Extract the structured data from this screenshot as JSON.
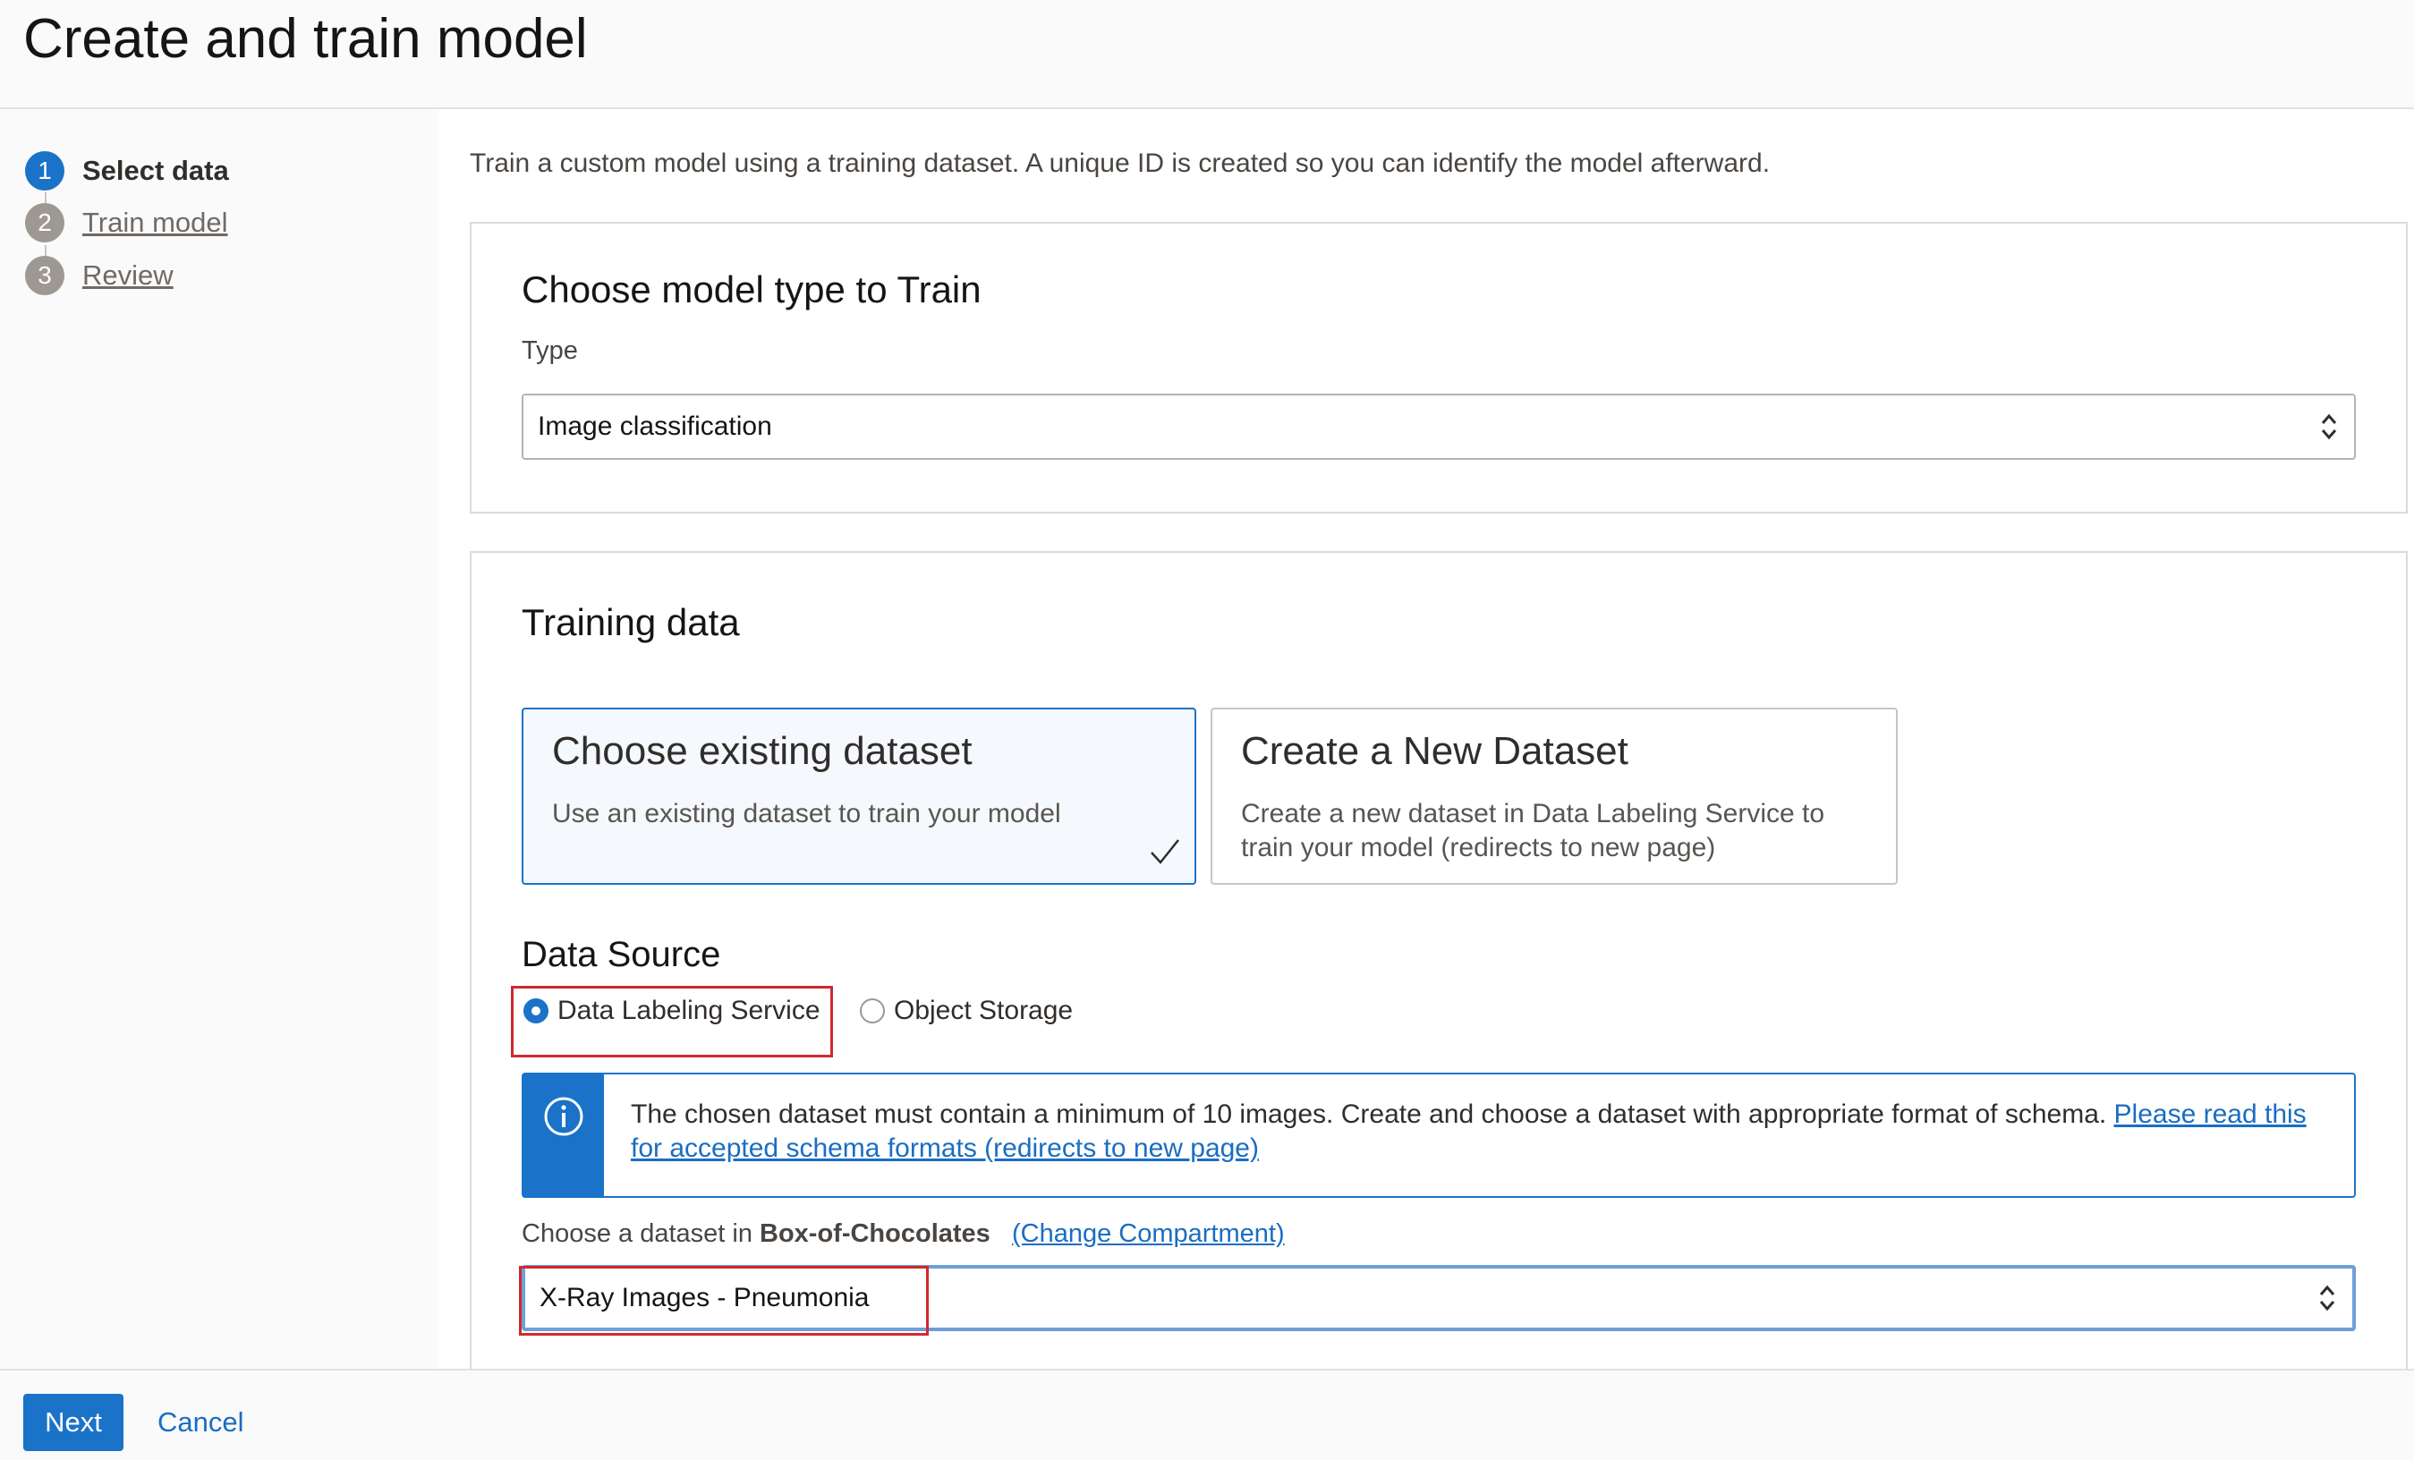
{
  "header": {
    "title": "Create and train model"
  },
  "steps": [
    {
      "num": "1",
      "label": "Select data"
    },
    {
      "num": "2",
      "label": "Train model"
    },
    {
      "num": "3",
      "label": "Review"
    }
  ],
  "intro": "Train a custom model using a training dataset. A unique ID is created so you can identify the model afterward.",
  "model_type": {
    "title": "Choose model type to Train",
    "type_label": "Type",
    "type_value": "Image classification"
  },
  "training_data": {
    "title": "Training data",
    "tiles": [
      {
        "title": "Choose existing dataset",
        "desc": "Use an existing dataset to train your model"
      },
      {
        "title": "Create a New Dataset",
        "desc": "Create a new dataset in Data Labeling Service to train your model (redirects to new page)"
      }
    ],
    "data_source_label": "Data Source",
    "radios": [
      {
        "label": "Data Labeling Service"
      },
      {
        "label": "Object Storage"
      }
    ],
    "info_text": "The chosen dataset must contain a minimum of 10 images. Create and choose a dataset with appropriate format of schema. ",
    "info_link": "Please read this for accepted schema formats (redirects to new page)",
    "dataset_prefix": "Choose a dataset in ",
    "compartment": "Box-of-Chocolates",
    "change_compartment": "(Change Compartment)",
    "dataset_value": "X-Ray Images - Pneumonia"
  },
  "footer": {
    "next": "Next",
    "cancel": "Cancel"
  },
  "colors": {
    "accent": "#1a73c8",
    "highlight": "#d1292e"
  }
}
